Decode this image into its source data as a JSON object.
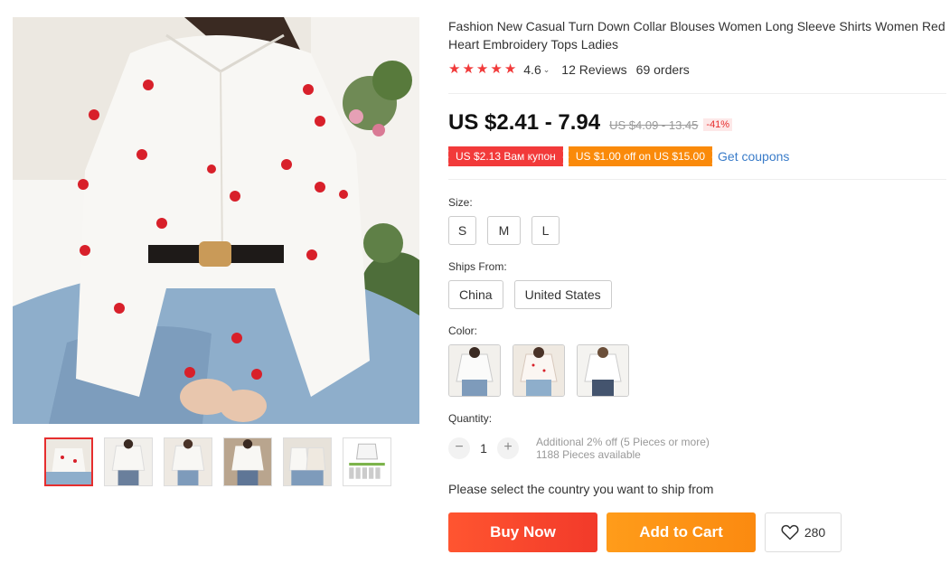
{
  "product": {
    "title": "Fashion New Casual Turn Down Collar Blouses Women Long Sleeve Shirts Women Red Heart Embroidery Tops Ladies",
    "main_image_icon": "product-photo-white-blouse-red-hearts",
    "thumbnails": [
      "thumb-1",
      "thumb-2",
      "thumb-3",
      "thumb-4",
      "thumb-5",
      "thumb-6"
    ]
  },
  "rating": {
    "stars": 5,
    "value": "4.6",
    "caret": "⌄",
    "reviews": "12 Reviews",
    "orders": "69 orders"
  },
  "price": {
    "current": "US $2.41 - 7.94",
    "original": "US $4.09 - 13.45",
    "discount": "-41%"
  },
  "coupons": {
    "red": "US $2.13 Вам купон",
    "orange": "US $1.00 off on US $15.00",
    "link": "Get coupons"
  },
  "size": {
    "label": "Size:",
    "options": [
      "S",
      "M",
      "L"
    ]
  },
  "ships_from": {
    "label": "Ships From:",
    "options": [
      "China",
      "United States"
    ]
  },
  "color": {
    "label": "Color:",
    "options": [
      "color-1",
      "color-2",
      "color-3"
    ]
  },
  "quantity": {
    "label": "Quantity:",
    "minus": "−",
    "plus": "+",
    "value": "1",
    "note_line1": "Additional 2% off (5 Pieces or more)",
    "note_line2": "1188 Pieces available"
  },
  "ship_message": "Please select the country you want to ship from",
  "actions": {
    "buy_now": "Buy Now",
    "add_to_cart": "Add to Cart",
    "wishlist_count": "280"
  },
  "colors": {
    "star": "#f13a3a",
    "buy_now": "#f23a2a",
    "add_to_cart": "#fb8a10",
    "coupon_red": "#f23a3a",
    "coupon_orange": "#fa8a0a",
    "link": "#3a7cc9"
  }
}
